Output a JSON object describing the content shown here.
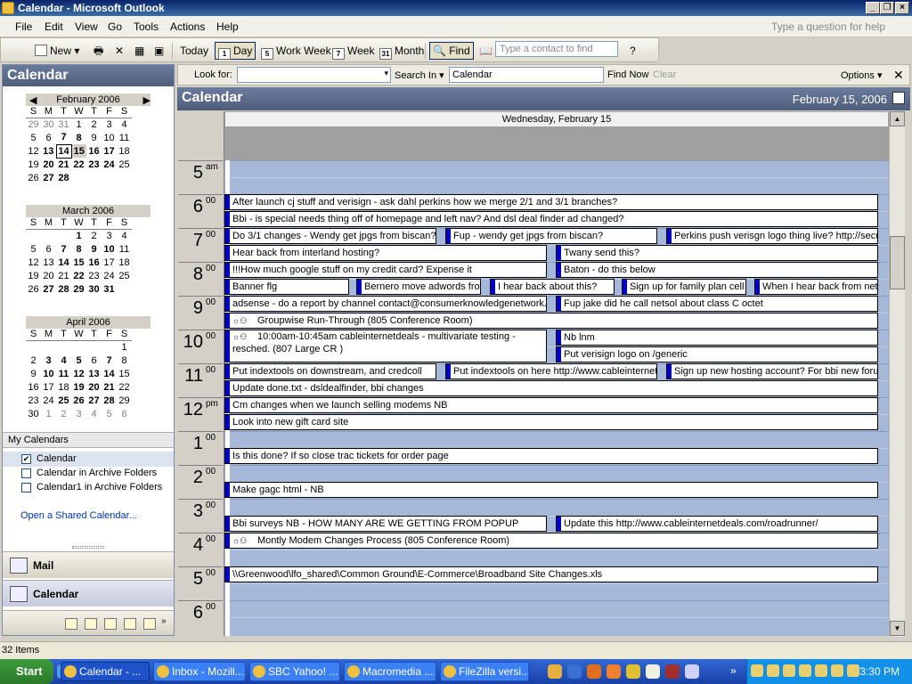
{
  "window": {
    "title": "Calendar - Microsoft Outlook"
  },
  "menu": {
    "items": [
      "File",
      "Edit",
      "View",
      "Go",
      "Tools",
      "Actions",
      "Help"
    ],
    "ask": "Type a question for help"
  },
  "toolbar": {
    "new_label": "New",
    "today_label": "Today",
    "day_label": "Day",
    "day_icon": "1",
    "workweek_label": "Work Week",
    "workweek_icon": "5",
    "week_label": "Week",
    "week_icon": "7",
    "month_label": "Month",
    "month_icon": "31",
    "find_label": "Find",
    "contact_placeholder": "Type a contact to find"
  },
  "left_pane": {
    "header": "Calendar",
    "months": [
      {
        "title": "February 2006",
        "dow": [
          "S",
          "M",
          "T",
          "W",
          "T",
          "F",
          "S"
        ],
        "weeks": [
          [
            "29",
            "30",
            "31",
            "1",
            "2",
            "3",
            "4"
          ],
          [
            "5",
            "6",
            "7",
            "8",
            "9",
            "10",
            "11"
          ],
          [
            "12",
            "13",
            "14",
            "15",
            "16",
            "17",
            "18"
          ],
          [
            "19",
            "20",
            "21",
            "22",
            "23",
            "24",
            "25"
          ],
          [
            "26",
            "27",
            "28",
            "",
            "",
            "",
            ""
          ]
        ]
      },
      {
        "title": "March 2006",
        "dow": [
          "S",
          "M",
          "T",
          "W",
          "T",
          "F",
          "S"
        ],
        "weeks": [
          [
            "",
            "",
            "",
            "1",
            "2",
            "3",
            "4"
          ],
          [
            "5",
            "6",
            "7",
            "8",
            "9",
            "10",
            "11"
          ],
          [
            "12",
            "13",
            "14",
            "15",
            "16",
            "17",
            "18"
          ],
          [
            "19",
            "20",
            "21",
            "22",
            "23",
            "24",
            "25"
          ],
          [
            "26",
            "27",
            "28",
            "29",
            "30",
            "31",
            ""
          ]
        ]
      },
      {
        "title": "April 2006",
        "dow": [
          "S",
          "M",
          "T",
          "W",
          "T",
          "F",
          "S"
        ],
        "weeks": [
          [
            "",
            "",
            "",
            "",
            "",
            "",
            "1"
          ],
          [
            "2",
            "3",
            "4",
            "5",
            "6",
            "7",
            "8"
          ],
          [
            "9",
            "10",
            "11",
            "12",
            "13",
            "14",
            "15"
          ],
          [
            "16",
            "17",
            "18",
            "19",
            "20",
            "21",
            "22"
          ],
          [
            "23",
            "24",
            "25",
            "26",
            "27",
            "28",
            "29"
          ],
          [
            "30",
            "1",
            "2",
            "3",
            "4",
            "5",
            "6"
          ]
        ]
      }
    ],
    "my_calendars_label": "My Calendars",
    "calendars": [
      {
        "label": "Calendar",
        "checked": true
      },
      {
        "label": "Calendar in Archive Folders",
        "checked": false
      },
      {
        "label": "Calendar1 in Archive Folders",
        "checked": false
      }
    ],
    "open_shared": "Open a Shared Calendar...",
    "nav": {
      "mail": "Mail",
      "calendar": "Calendar"
    }
  },
  "find_bar": {
    "look_for_label": "Look for:",
    "search_in_label": "Search In",
    "search_in_value": "Calendar",
    "find_now": "Find Now",
    "clear": "Clear",
    "options": "Options"
  },
  "calendar": {
    "title": "Calendar",
    "date": "February 15, 2006",
    "day_header": "Wednesday, February 15",
    "hours": [
      {
        "h": "5",
        "m": "am"
      },
      {
        "h": "6",
        "m": "00"
      },
      {
        "h": "7",
        "m": "00"
      },
      {
        "h": "8",
        "m": "00"
      },
      {
        "h": "9",
        "m": "00"
      },
      {
        "h": "10",
        "m": "00"
      },
      {
        "h": "11",
        "m": "00"
      },
      {
        "h": "12",
        "m": "pm"
      },
      {
        "h": "1",
        "m": "00"
      },
      {
        "h": "2",
        "m": "00"
      },
      {
        "h": "3",
        "m": "00"
      },
      {
        "h": "4",
        "m": "00"
      },
      {
        "h": "5",
        "m": "00"
      },
      {
        "h": "6",
        "m": "00"
      }
    ],
    "appointments": [
      {
        "text": "After launch cj stuff and verisign - ask dahl perkins how we merge 2/1 and 3/1 branches?"
      },
      {
        "text": "Bbi - is special needs thing off of homepage and left nav? And dsl deal finder ad changed?"
      },
      {
        "text": "Do 3/1 changes - Wendy get jpgs from biscan?"
      },
      {
        "text": "Fup - wendy get jpgs from biscan?"
      },
      {
        "text": "Perkins push verisgn logo thing live?  http://secure"
      },
      {
        "text": "Hear back from interland hosting?"
      },
      {
        "text": "Twany send this?"
      },
      {
        "text": "!!!How much google stuff on my credit card? Expense it"
      },
      {
        "text": "Baton - do this below"
      },
      {
        "text": "Banner flg"
      },
      {
        "text": "Bernero move adwords from"
      },
      {
        "text": "I hear back about this?"
      },
      {
        "text": "Sign up for family plan cell pl"
      },
      {
        "text": "When I hear back from netsol"
      },
      {
        "text": "adsense - do a report by channel  contact@consumerknowledgenetwork.com"
      },
      {
        "text": "Fup jake did he call netsol about class C octet"
      },
      {
        "text": "Groupwise Run-Through (805 Conference Room)"
      },
      {
        "text": "10:00am-10:45am cableinternetdeals - multivariate testing - resched. (807 Large CR )"
      },
      {
        "text": "Nb lnm"
      },
      {
        "text": "Put verisign logo on /generic"
      },
      {
        "text": "Put indextools on downstream, and credcoll"
      },
      {
        "text": "Put indextools on here http://www.cableinternetdeals.com"
      },
      {
        "text": "Sign up new hosting account? For bbi new forum?"
      },
      {
        "text": "Update done.txt - dsldealfinder, bbi changes"
      },
      {
        "text": "Cm changes when we launch selling modems NB"
      },
      {
        "text": "Look into new gift card site"
      },
      {
        "text": "Is this done? If so close trac tickets for order page"
      },
      {
        "text": "Make gagc html - NB"
      },
      {
        "text": "Bbi surveys NB - HOW MANY ARE WE GETTING FROM POPUP"
      },
      {
        "text": "Update this http://www.cableinternetdeals.com/roadrunner/"
      },
      {
        "text": "Montly Modem Changes Process (805 Conference Room)"
      },
      {
        "text": "\\\\Greenwood\\lfo_shared\\Common Ground\\E-Commerce\\Broadband Site Changes.xls"
      }
    ]
  },
  "status": {
    "items": "32 Items"
  },
  "taskbar": {
    "start": "Start",
    "tasks": [
      "Calendar - ...",
      "Inbox - Mozill...",
      "SBC Yahoo! ...",
      "Macromedia ...",
      "FileZilla versi..."
    ],
    "clock": "3:30 PM"
  }
}
